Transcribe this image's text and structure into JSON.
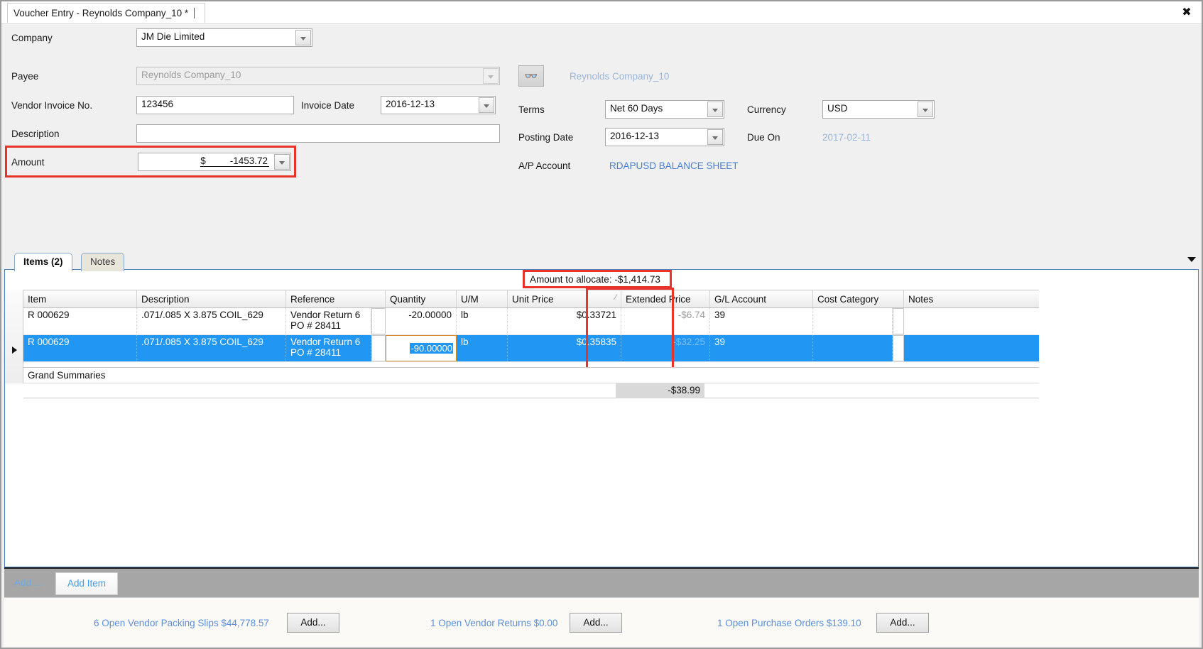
{
  "window": {
    "tab_title": "Voucher Entry - Reynolds Company_10 *",
    "close_label": "✖"
  },
  "form": {
    "company_label": "Company",
    "company_value": "JM Die Limited",
    "payee_label": "Payee",
    "payee_value": "Reynolds Company_10",
    "payee_link": "Reynolds Company_10",
    "lookup_icon": "binoculars-icon",
    "vendor_invoice_label": "Vendor Invoice No.",
    "vendor_invoice_value": "123456",
    "invoice_date_label": "Invoice Date",
    "invoice_date_value": "2016-12-13",
    "description_label": "Description",
    "description_value": "",
    "amount_label": "Amount",
    "amount_currency": "$",
    "amount_value": "-1453.72",
    "terms_label": "Terms",
    "terms_value": "Net 60 Days",
    "currency_label": "Currency",
    "currency_value": "USD",
    "posting_date_label": "Posting Date",
    "posting_date_value": "2016-12-13",
    "due_on_label": "Due On",
    "due_on_value": "2017-02-11",
    "ap_account_label": "A/P Account",
    "ap_account_value": "RDAPUSD BALANCE SHEET"
  },
  "tabs": [
    {
      "label": "Items (2)",
      "active": true
    },
    {
      "label": "Notes",
      "active": false
    }
  ],
  "grid": {
    "allocate_note": "Amount to allocate: -$1,414.73",
    "columns": [
      "Item",
      "Description",
      "Reference",
      "Quantity",
      "U/M",
      "Unit Price",
      "Extended Price",
      "G/L Account",
      "Cost Category",
      "Notes"
    ],
    "unit_price_sort_mark": "⁄",
    "rows": [
      {
        "item": "R 000629",
        "description": ".071/.085 X 3.875 COIL_629",
        "reference_line1": "Vendor Return 6",
        "reference_line2": "PO # 28411",
        "quantity": "-20.00000",
        "um": "lb",
        "unit_price": "$0.33721",
        "extended_price": "-$6.74",
        "gl_account": "39",
        "cost_category": "",
        "notes": ""
      },
      {
        "item": "R 000629",
        "description": ".071/.085 X 3.875 COIL_629",
        "reference_line1": "Vendor Return 6",
        "reference_line2": "PO # 28411",
        "quantity": "-90.00000",
        "um": "lb",
        "unit_price": "$0.35835",
        "extended_price": "-$32.25",
        "gl_account": "39",
        "cost_category": "",
        "notes": ""
      }
    ],
    "summary_label": "Grand Summaries",
    "summary_total": "-$38.99"
  },
  "addbar": {
    "add_dim_label": "Add ...",
    "add_item_label": "Add Item"
  },
  "footer": {
    "packing_slips_label": "6 Open Vendor Packing Slips $44,778.57",
    "packing_slips_button": "Add...",
    "vendor_returns_label": "1 Open Vendor Returns $0.00",
    "vendor_returns_button": "Add...",
    "purchase_orders_label": "1 Open Purchase Orders $139.10",
    "purchase_orders_button": "Add..."
  },
  "colors": {
    "highlight_red": "#e8332a",
    "selection_blue": "#2196f3",
    "link_blue": "#4a7fd4"
  }
}
